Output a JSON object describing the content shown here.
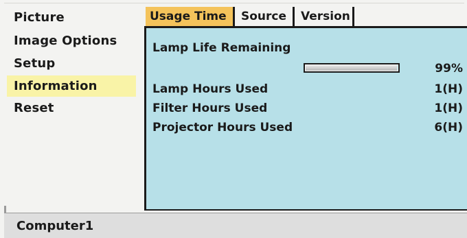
{
  "menu": {
    "items": [
      {
        "label": "Picture"
      },
      {
        "label": "Image Options"
      },
      {
        "label": "Setup"
      },
      {
        "label": "Information"
      },
      {
        "label": "Reset"
      }
    ],
    "selected": "Information"
  },
  "tabs": [
    {
      "label": "Usage Time",
      "active": true
    },
    {
      "label": "Source",
      "active": false
    },
    {
      "label": "Version",
      "active": false
    }
  ],
  "usage": {
    "lamp_life_label": "Lamp Life Remaining",
    "lamp_life_value": "99%",
    "lamp_life_fraction": 0.99,
    "lamp_hours_label": "Lamp Hours Used",
    "lamp_hours_value": "1(H)",
    "filter_hours_label": "Filter Hours Used",
    "filter_hours_value": "1(H)",
    "projector_hours_label": "Projector Hours Used",
    "projector_hours_value": "6(H)"
  },
  "footer": {
    "source_label": "Computer1"
  },
  "colors": {
    "panel_bg": "#b7e0e8",
    "active_tab": "#f4c35b",
    "selected_menu": "#f9f3a7",
    "footer_bg": "#dedede"
  }
}
